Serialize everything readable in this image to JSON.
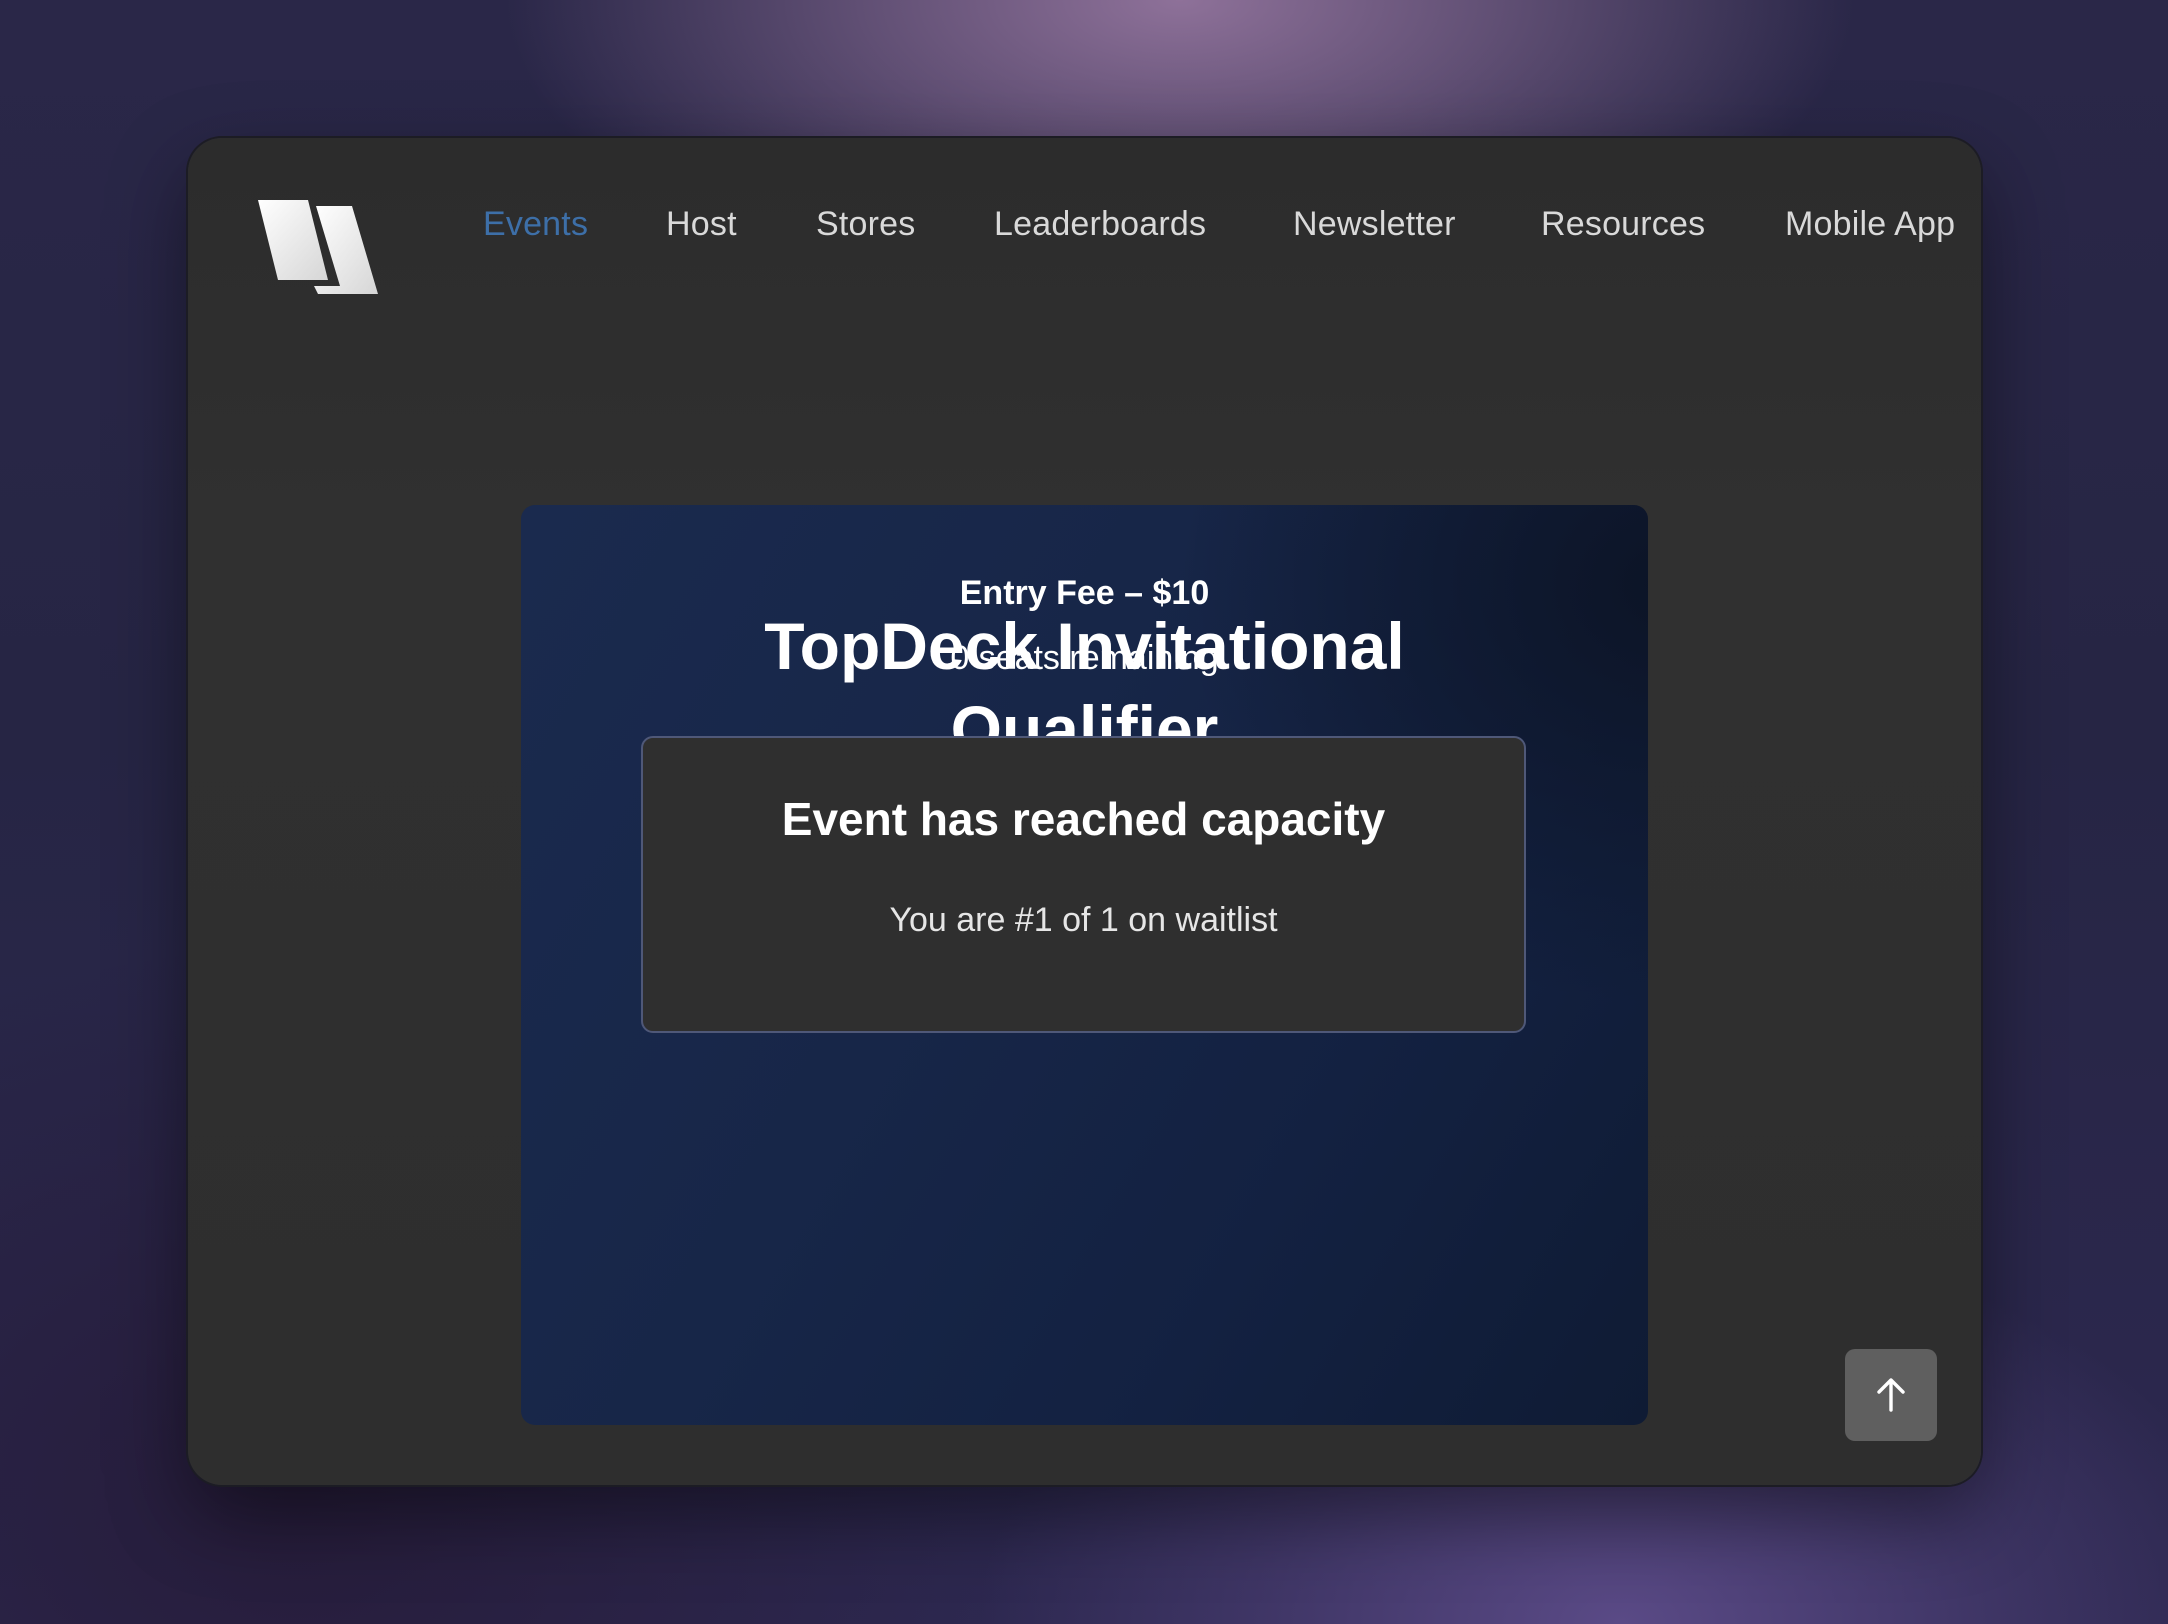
{
  "nav": {
    "logo_icon": "brand-logo-icon",
    "items": [
      {
        "label": "Events",
        "active": true
      },
      {
        "label": "Host",
        "active": false
      },
      {
        "label": "Stores",
        "active": false
      },
      {
        "label": "Leaderboards",
        "active": false
      },
      {
        "label": "Newsletter",
        "active": false
      },
      {
        "label": "Resources",
        "active": false
      },
      {
        "label": "Mobile App",
        "active": false
      }
    ]
  },
  "event": {
    "title_line1": "TopDeck Invitational",
    "title_line2": "Qualifier",
    "entry_fee": "Entry Fee – $10",
    "seats_remaining": "0 seats remaining"
  },
  "capacity_notice": {
    "title": "Event has reached capacity",
    "waitlist": "You are #1 of 1 on waitlist"
  },
  "scroll_top": {
    "icon": "arrow-up-icon"
  },
  "colors": {
    "active_nav": "#3d6fa8",
    "window_bg": "#2e2e2e",
    "card_bg": "#172648",
    "notice_bg": "#2f2f2f"
  }
}
